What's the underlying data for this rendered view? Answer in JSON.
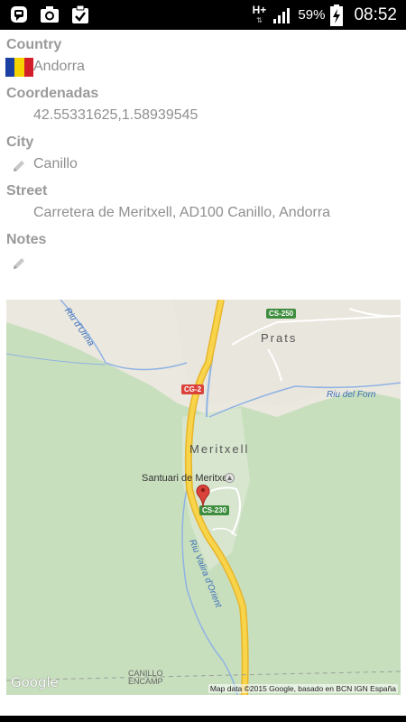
{
  "status_bar": {
    "network": "H+",
    "battery_percent": "59%",
    "time": "08:52",
    "icons": [
      "bbm-icon",
      "camera-icon",
      "clipboard-check-icon",
      "signal-icon",
      "battery-charging-icon"
    ]
  },
  "fields": {
    "country": {
      "label": "Country",
      "value": "Andorra"
    },
    "coordinates": {
      "label": "Coordenadas",
      "value": "42.55331625,1.58939545"
    },
    "city": {
      "label": "City",
      "value": "Canillo"
    },
    "street": {
      "label": "Street",
      "value": "Carretera de Meritxell, AD100 Canillo, Andorra"
    },
    "notes": {
      "label": "Notes",
      "value": ""
    }
  },
  "map": {
    "places": [
      "Prats",
      "Meritxell"
    ],
    "poi": "Santuari de Meritxell",
    "roads": [
      "CS-250",
      "CG-2",
      "CS-230"
    ],
    "rivers": [
      "Riu d'Urina",
      "Riu del Forn",
      "Riu Valira d'Orient"
    ],
    "town": "CANILLO\nENCAMP",
    "attribution": "Map data ©2015 Google, basado en BCN IGN España",
    "logo": "Google"
  },
  "colors": {
    "label": "#9a9a9a",
    "value": "#8f8f8f",
    "road": "#f4c430",
    "road_secondary": "#ffffff",
    "marker": "#d9433b"
  }
}
